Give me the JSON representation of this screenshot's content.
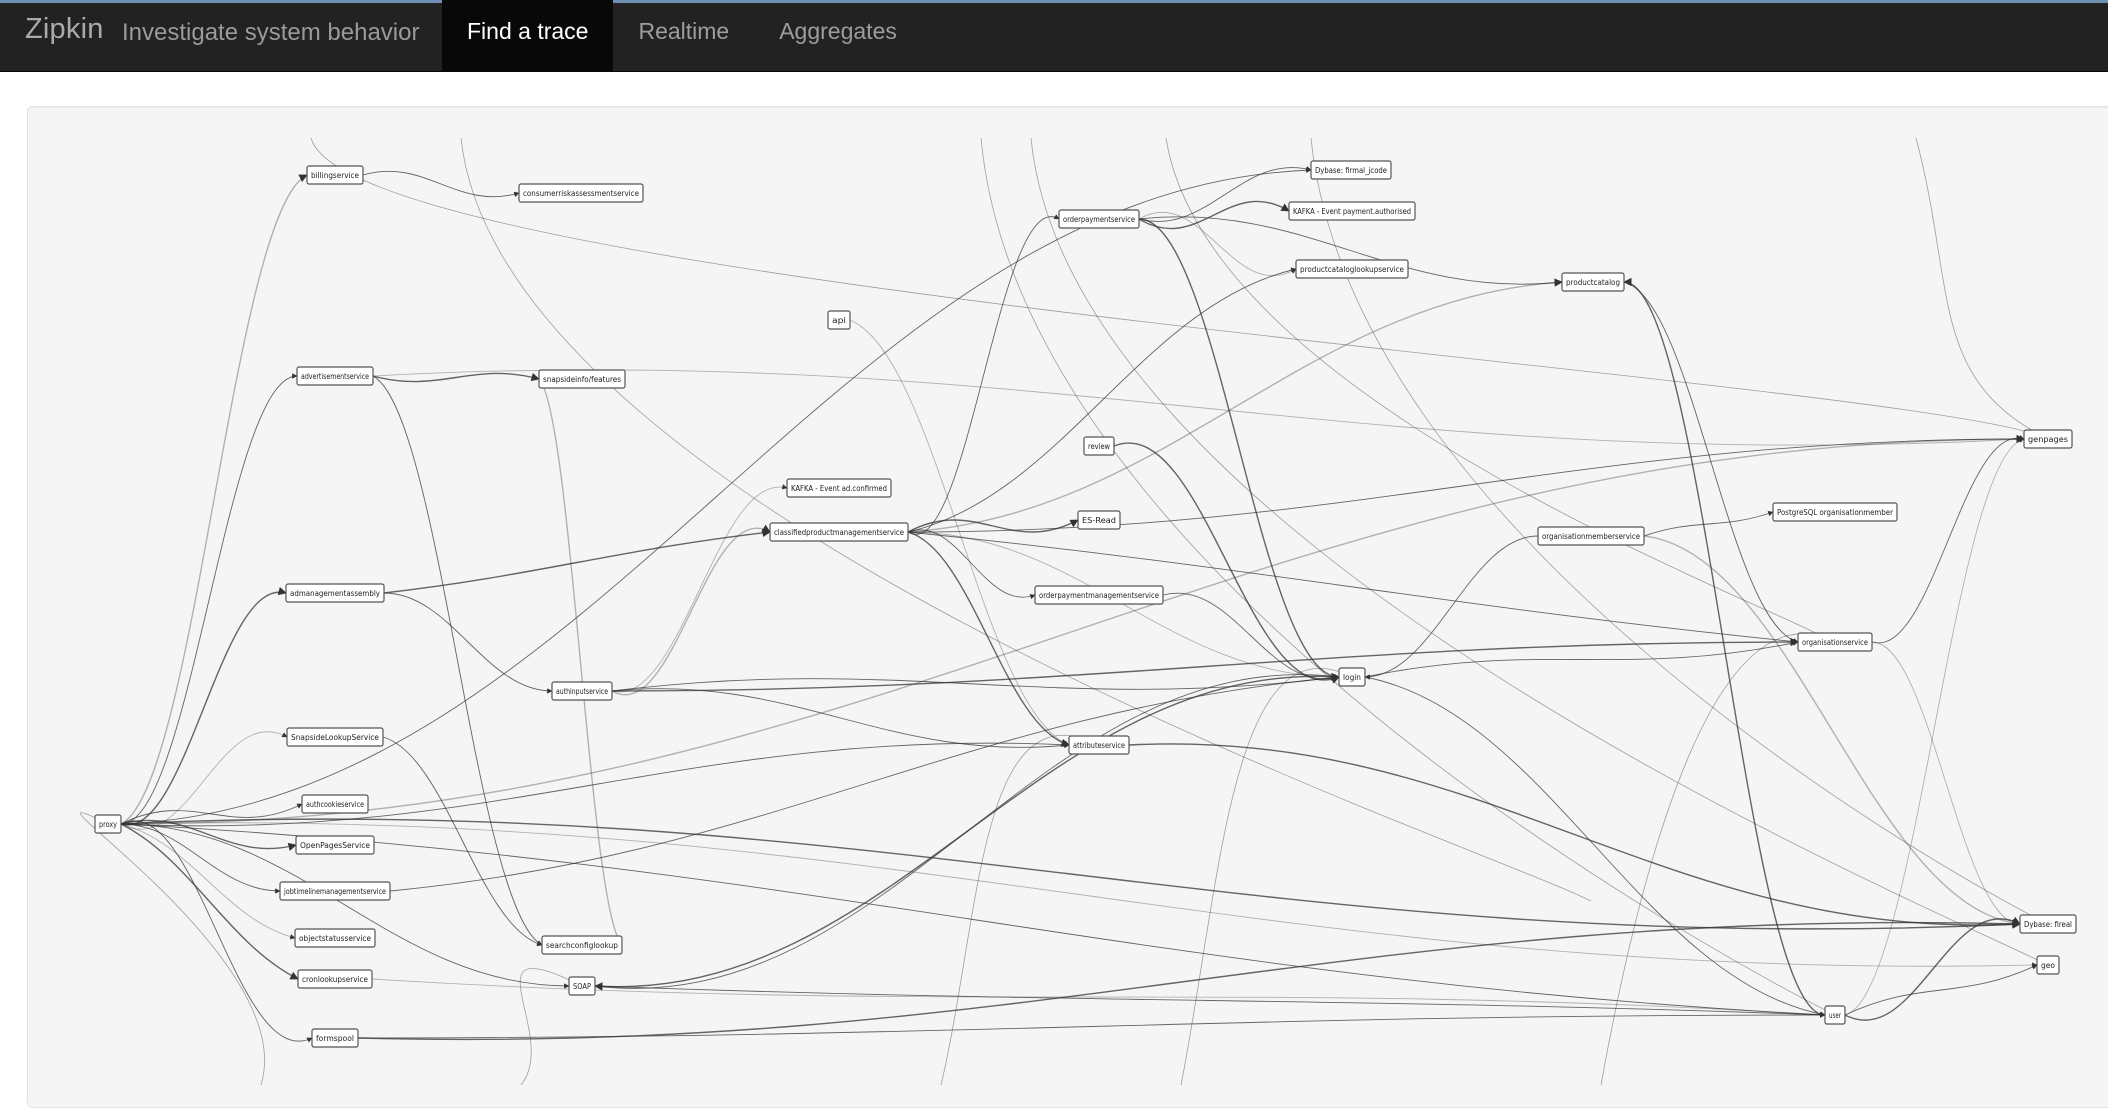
{
  "header": {
    "brand": "Zipkin",
    "tagline": "Investigate system behavior",
    "nav": [
      {
        "label": "Find a trace",
        "active": true
      },
      {
        "label": "Realtime",
        "active": false
      },
      {
        "label": "Aggregates",
        "active": false
      }
    ]
  },
  "dependency_graph": {
    "nodes": [
      {
        "id": "billingservice",
        "label": "billingservice"
      },
      {
        "id": "consumerriskassessment",
        "label": "consumerriskassessmentservice"
      },
      {
        "id": "orderpaymentservice",
        "label": "orderpaymentservice"
      },
      {
        "id": "dbase_fiirmal_jcode",
        "label": "Dybase: firmal_jcode"
      },
      {
        "id": "kafka_payment",
        "label": "KAFKA - Event payment.authorised"
      },
      {
        "id": "productcataloglookup",
        "label": "productcataloglookupservice"
      },
      {
        "id": "productcatalog",
        "label": "productcatalog"
      },
      {
        "id": "api",
        "label": "api"
      },
      {
        "id": "advertisement",
        "label": "advertisementservice"
      },
      {
        "id": "snapsideinfo",
        "label": "snapsideinfo/features"
      },
      {
        "id": "genpages",
        "label": "genpages"
      },
      {
        "id": "review",
        "label": "review"
      },
      {
        "id": "kafka_ad",
        "label": "KAFKA - Event ad.confirmed"
      },
      {
        "id": "es_read",
        "label": "ES-Read"
      },
      {
        "id": "classified",
        "label": "classifiedproductmanagementservice"
      },
      {
        "id": "postgresql",
        "label": "PostgreSQL organisationmember"
      },
      {
        "id": "orgmember",
        "label": "organisationmemberservice"
      },
      {
        "id": "admanagement",
        "label": "admanagementassembly"
      },
      {
        "id": "orderpaymentmgmt",
        "label": "orderpaymentmanagementservice"
      },
      {
        "id": "organisation",
        "label": "organisationservice"
      },
      {
        "id": "login",
        "label": "login"
      },
      {
        "id": "authinput",
        "label": "authinputservice"
      },
      {
        "id": "snapsidelookup",
        "label": "SnapsideLookupService"
      },
      {
        "id": "attributeservice",
        "label": "attributeservice"
      },
      {
        "id": "proxy",
        "label": "proxy"
      },
      {
        "id": "authcookie",
        "label": "authcookieservice"
      },
      {
        "id": "openpages",
        "label": "OpenPagesService"
      },
      {
        "id": "jobtimeline",
        "label": "jobtimelinemanagementservice"
      },
      {
        "id": "objectstatus",
        "label": "objectstatusservice"
      },
      {
        "id": "searchconfig",
        "label": "searchconfiglookup"
      },
      {
        "id": "cronlookup",
        "label": "cronlookupservice"
      },
      {
        "id": "soap",
        "label": "SOAP"
      },
      {
        "id": "dbase_fireal",
        "label": "Dybase: fireal"
      },
      {
        "id": "geo",
        "label": "geo"
      },
      {
        "id": "user",
        "label": "user"
      },
      {
        "id": "formspool",
        "label": "formspool"
      }
    ]
  },
  "colors": {
    "navbar": "#222222",
    "active_tab": "#080808",
    "panel": "#f5f5f5"
  }
}
